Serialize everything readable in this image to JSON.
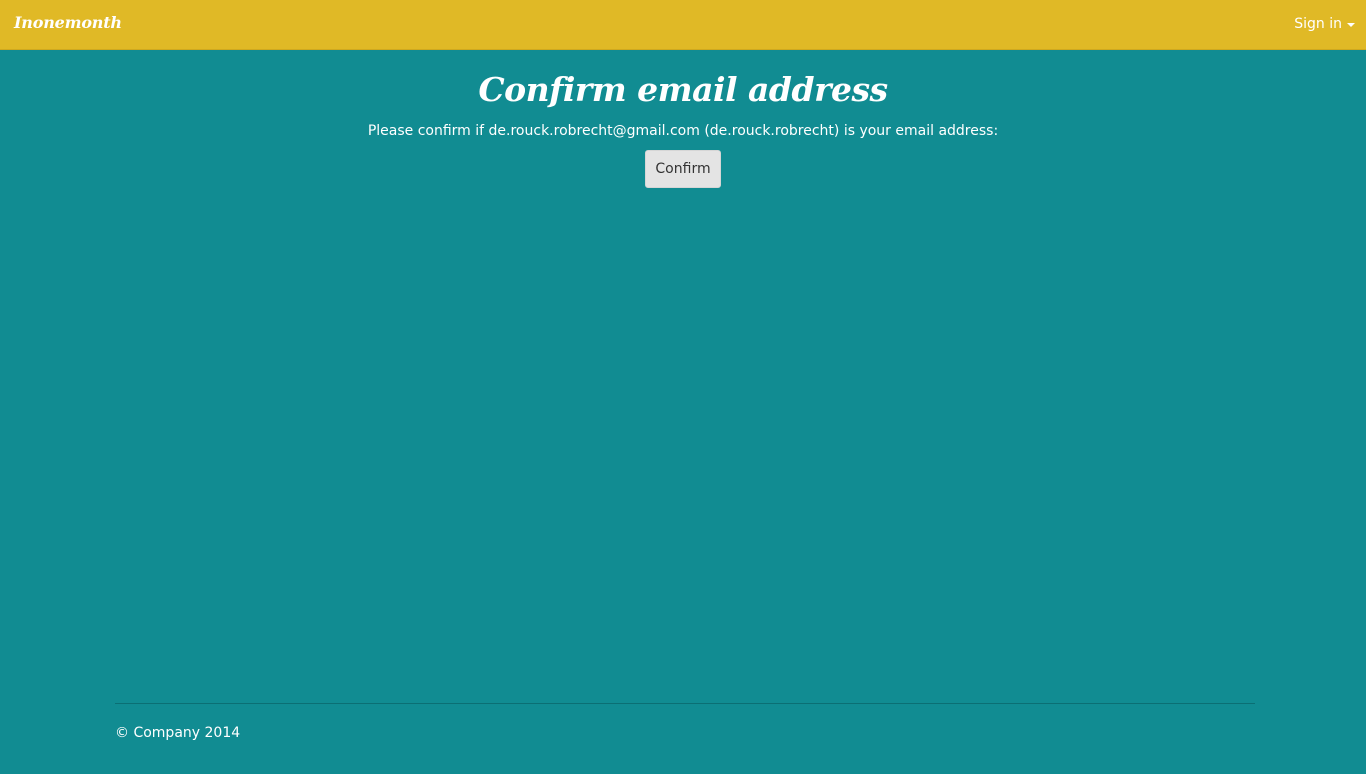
{
  "navbar": {
    "brand": "Inonemonth",
    "signin_label": "Sign in",
    "background_color": "#e0b926",
    "signin_icon": "caret-down-icon"
  },
  "main": {
    "title": "Confirm email address",
    "message": "Please confirm if de.rouck.robrecht@gmail.com (de.rouck.robrecht) is your email address:",
    "confirm_label": "Confirm",
    "background_color": "#118c92"
  },
  "footer": {
    "copyright": "© Company 2014"
  }
}
